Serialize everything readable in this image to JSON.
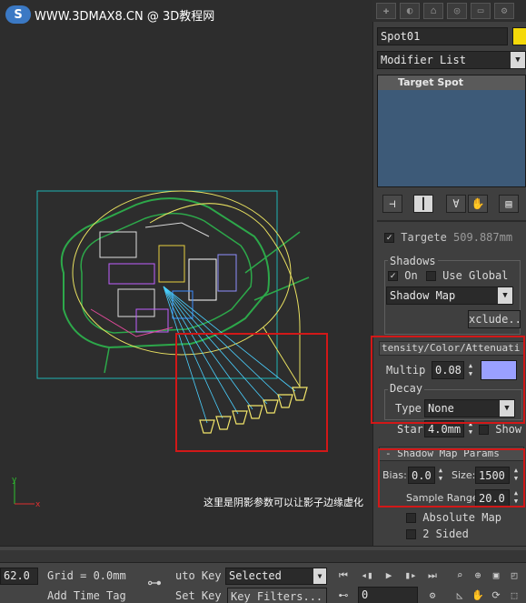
{
  "watermark": {
    "logo": "S",
    "text": "WWW.3DMAX8.CN @ 3D教程网"
  },
  "viewport": {
    "annotation": "这里是阴影参数可以让影子边缘虚化",
    "axis": {
      "x": "x",
      "y": "y"
    }
  },
  "panel": {
    "object_name": "Spot01",
    "object_color": "#f5d90a",
    "modifier_list": "Modifier List",
    "stack_item": "Target Spot",
    "stack_tools": [
      "pin-stack-icon",
      "show-end-result-icon",
      "make-unique-icon",
      "remove-modifier-icon",
      "configure-sets-icon"
    ],
    "target_row": {
      "label": "Targete",
      "value": "509.887mm",
      "checked": true
    },
    "shadows": {
      "group_label": "Shadows",
      "on_label": "On",
      "on_checked": true,
      "use_global_label": "Use Global",
      "use_global_checked": false,
      "type": "Shadow Map",
      "exclude_label": "xclude.."
    },
    "intensity": {
      "rollout_title": "tensity/Color/Attenuati",
      "multiplier_label": "Multip",
      "multiplier_value": "0.08",
      "swatch_color": "#9aa0ff",
      "decay_label": "Decay",
      "type_label": "Type",
      "type_value": "None",
      "start_label": "Star",
      "start_value": "4.0mm",
      "show_label": "Show",
      "show_checked": false
    },
    "shadow_map": {
      "rollout_title": "- Shadow Map Params",
      "bias_label": "Bias:",
      "bias_value": "0.0",
      "size_label": "Size:",
      "size_value": "1500",
      "sample_range_label": "Sample Range:",
      "sample_range_value": "20.0",
      "absolute_map_label": "Absolute Map",
      "absolute_map_checked": false,
      "two_sided_label": "2 Sided",
      "two_sided_checked": false
    }
  },
  "bottom": {
    "coord_value": "62.0",
    "grid_label": "Grid = 0.0mm",
    "add_time_tag": "Add Time Tag",
    "auto_key": "uto Key",
    "set_key": "Set Key",
    "selected": "Selected",
    "key_filters": "Key Filters...",
    "frame_value": "0",
    "key_icon": "key-icon"
  }
}
